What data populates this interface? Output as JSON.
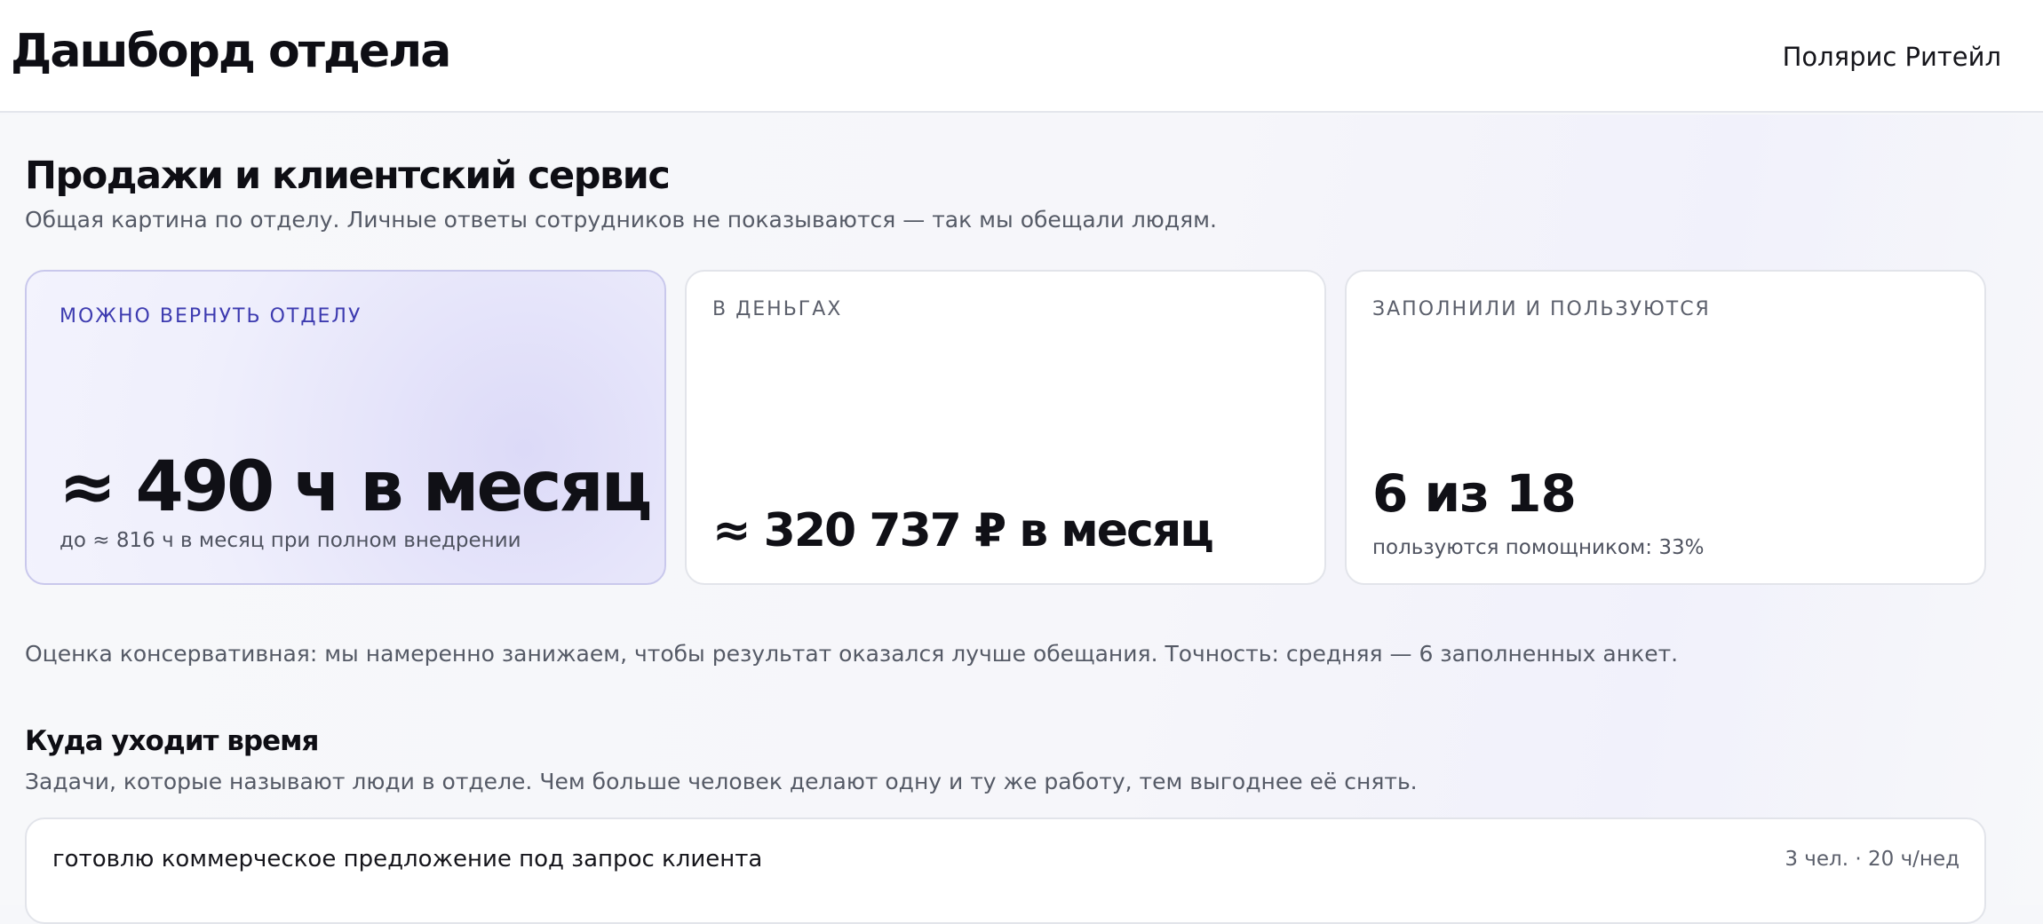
{
  "header": {
    "title": "Дашборд отдела",
    "organization": "Полярис Ритейл"
  },
  "section": {
    "title": "Продажи и клиентский сервис",
    "subtitle": "Общая картина по отделу. Личные ответы сотрудников не показываются — так мы обещали людям."
  },
  "cards": {
    "hours": {
      "label": "МОЖНО ВЕРНУТЬ ОТДЕЛУ",
      "value": "≈ 490 ч в месяц",
      "note": "до ≈ 816 ч в месяц при полном внедрении"
    },
    "money": {
      "label": "В ДЕНЬГАХ",
      "value": "≈ 320 737 ₽ в месяц"
    },
    "adoption": {
      "label": "ЗАПОЛНИЛИ И ПОЛЬЗУЮТСЯ",
      "value": "6 из 18",
      "note": "пользуются помощником: 33%"
    }
  },
  "disclaimer": "Оценка консервативная: мы намеренно занижаем, чтобы результат оказался лучше обещания. Точность: средняя — 6 заполненных анкет.",
  "time_section": {
    "title": "Куда уходит время",
    "subtitle": "Задачи, которые называют люди в отделе. Чем больше человек делают одну и ту же работу, тем выгоднее её снять.",
    "tasks": [
      {
        "name": "готовлю коммерческое предложение под запрос клиента",
        "meta": "3 чел. · 20 ч/нед"
      }
    ]
  },
  "colors": {
    "accent": "#3d3bb0",
    "text": "#101016",
    "muted": "#555a66",
    "border": "#e2e4ea"
  }
}
